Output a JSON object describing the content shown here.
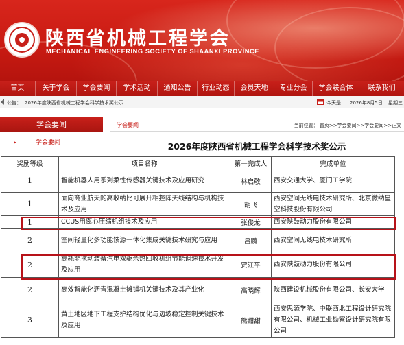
{
  "banner": {
    "title": "陕西省机械工程学会",
    "subtitle": "MECHANICAL ENGINEERING SOCIETY OF SHAANXI PROVINCE",
    "logo_icon": "society-seal-icon",
    "color": "#c8201a"
  },
  "nav": {
    "items": [
      "首页",
      "关于学会",
      "学会要闻",
      "学术活动",
      "通知公告",
      "行业动态",
      "会员天地",
      "专业分会",
      "学会联合体",
      "联系我们"
    ]
  },
  "notice": {
    "label": "公告：",
    "message": "2026年度陕西省机械工程学会科学技术奖公示",
    "today_label": "今天是",
    "date": "2026年8月5日",
    "weekday": "星期三"
  },
  "sidebar": {
    "heading": "学会要闻",
    "items": [
      {
        "bullet": "▸",
        "label": "学会要闻"
      }
    ]
  },
  "content": {
    "section": "学会要闻",
    "breadcrumb": "当前位置： 首页>>学会要闻>>学会要闻>>正文",
    "title": "2026年度陕西省机械工程学会科学技术奖公示"
  },
  "table": {
    "headers": [
      "奖励等级",
      "项目名称",
      "第一完成人",
      "完成单位"
    ],
    "rows": [
      {
        "level": "1",
        "project": "智能机器人用系列柔性传感器关键技术及应用研究",
        "person": "林启敬",
        "unit": "西安交通大学、厦门工学院",
        "highlight": false
      },
      {
        "level": "1",
        "project": "面向商业航天的高收纳比可展开相控阵天线结构与机构技术及应用",
        "person": "胡飞",
        "unit": "西安空间无线电技术研究所、北京微纳星空科技股份有限公司",
        "highlight": false
      },
      {
        "level": "1",
        "project": "CCUS用离心压缩机组技术及应用",
        "person": "张俊龙",
        "unit": "西安陕鼓动力股份有限公司",
        "highlight": true
      },
      {
        "level": "2",
        "project": "空间轻量化多功能馈源一体化集成关键技术研究与应用",
        "person": "吕鹏",
        "unit": "西安空间无线电技术研究所",
        "highlight": false
      },
      {
        "level": "2",
        "project": "高耗能拖动装备汽电双驱余热回收机组节能调速技术开发及应用",
        "person": "贾江平",
        "unit": "西安陕鼓动力股份有限公司",
        "highlight": true
      },
      {
        "level": "2",
        "project": "高效智能化沥青混凝土摊铺机关键技术及其产业化",
        "person": "高晓辉",
        "unit": "陕西建设机械股份有限公司、长安大学",
        "highlight": false
      },
      {
        "level": "3",
        "project": "黄土地区地下工程支护结构优化与边坡稳定控制关键技术及应用",
        "person": "熊甜甜",
        "unit": "西安思源学院、中联西北工程设计研究院有限公司、机械工业勘察设计研究院有限公司",
        "highlight": false
      }
    ],
    "highlight_color": "#b71219"
  }
}
